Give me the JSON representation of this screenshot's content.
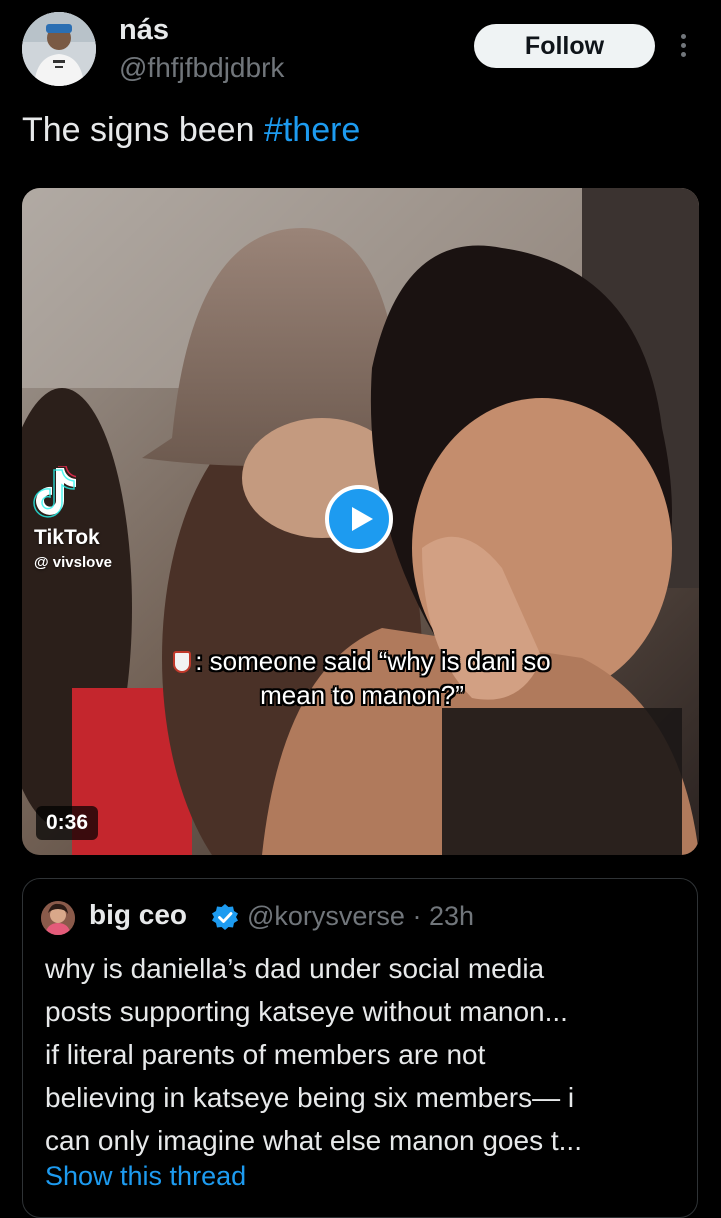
{
  "author": {
    "display_name": "nás",
    "handle": "@fhfjfbdjdbrk"
  },
  "follow_label": "Follow",
  "more_icon": "more-vertical-icon",
  "post": {
    "text": "The signs been ",
    "hashtag": "#there"
  },
  "media": {
    "watermark_brand": "TikTok",
    "watermark_user": "@ vivslove",
    "caption_line1": ": someone said “why is dani so",
    "caption_line2": "mean to manon?”",
    "duration": "0:36",
    "play_icon": "play-icon"
  },
  "quote": {
    "display_name": "big ceo",
    "verified_icon": "verified-badge-icon",
    "handle": "@korysverse",
    "time": "23h",
    "lines": [
      "why is daniella’s dad under social media",
      "posts supporting katseye without manon...",
      "if literal parents of members are not",
      "believing in katseye being six members— i",
      "can only imagine what else manon goes t..."
    ],
    "show_thread": "Show this thread"
  },
  "colors": {
    "background": "#000000",
    "accent": "#1d9bf0",
    "text": "#e7e9ea",
    "secondary": "#71767b",
    "border": "#2f3336"
  }
}
